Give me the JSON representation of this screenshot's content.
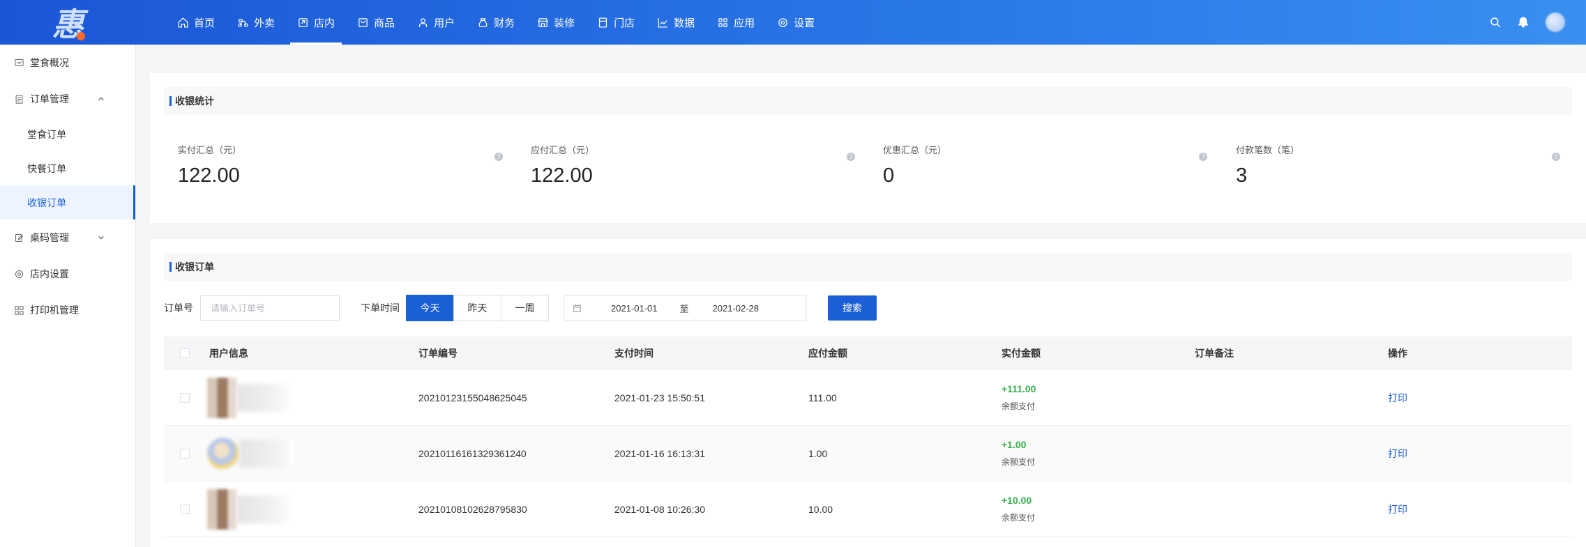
{
  "logo": {
    "text": "惠"
  },
  "nav": {
    "items": [
      {
        "label": "首页",
        "icon": "home-icon"
      },
      {
        "label": "外卖",
        "icon": "bike-icon"
      },
      {
        "label": "店内",
        "icon": "store-icon",
        "active": true
      },
      {
        "label": "商品",
        "icon": "bag-icon"
      },
      {
        "label": "用户",
        "icon": "user-icon"
      },
      {
        "label": "财务",
        "icon": "money-icon"
      },
      {
        "label": "装修",
        "icon": "shop-icon"
      },
      {
        "label": "门店",
        "icon": "door-icon"
      },
      {
        "label": "数据",
        "icon": "chart-icon"
      },
      {
        "label": "应用",
        "icon": "grid-icon"
      },
      {
        "label": "设置",
        "icon": "gear-icon"
      }
    ]
  },
  "sidebar": {
    "overview": "堂食概况",
    "orders": "订单管理",
    "orders_sub": [
      "堂食订单",
      "快餐订单",
      "收银订单"
    ],
    "table_codes": "桌码管理",
    "store_settings": "店内设置",
    "printer": "打印机管理"
  },
  "stats": {
    "title": "收银统计",
    "items": [
      {
        "label": "实付汇总（元）",
        "value": "122.00"
      },
      {
        "label": "应付汇总（元）",
        "value": "122.00"
      },
      {
        "label": "优惠汇总（元）",
        "value": "0"
      },
      {
        "label": "付款笔数（笔）",
        "value": "3"
      }
    ]
  },
  "orders": {
    "title": "收银订单",
    "filter": {
      "order_no_label": "订单号",
      "order_no_placeholder": "请输入订单号",
      "time_label": "下单时间",
      "segments": [
        "今天",
        "昨天",
        "一周"
      ],
      "active_segment": "今天",
      "date_start": "2021-01-01",
      "date_to": "至",
      "date_end": "2021-02-28",
      "search": "搜索"
    },
    "columns": [
      "用户信息",
      "订单编号",
      "支付时间",
      "应付金额",
      "实付金额",
      "订单备注",
      "操作"
    ],
    "rows": [
      {
        "user_suffix": "16",
        "order_no": "20210123155048625045",
        "pay_time": "2021-01-23 15:50:51",
        "payable": "111.00",
        "paid": "+111.00",
        "method": "余额支付",
        "remark": "",
        "action": "打印"
      },
      {
        "user_suffix": "",
        "order_no": "20210116161329361240",
        "pay_time": "2021-01-16 16:13:31",
        "payable": "1.00",
        "paid": "+1.00",
        "method": "余额支付",
        "remark": "",
        "action": "打印"
      },
      {
        "user_suffix": "",
        "order_no": "20210108102628795830",
        "pay_time": "2021-01-08 10:26:30",
        "payable": "10.00",
        "paid": "+10.00",
        "method": "余额支付",
        "remark": "",
        "action": "打印"
      }
    ]
  },
  "colors": {
    "primary": "#1b5fd6",
    "success": "#36b04a"
  }
}
